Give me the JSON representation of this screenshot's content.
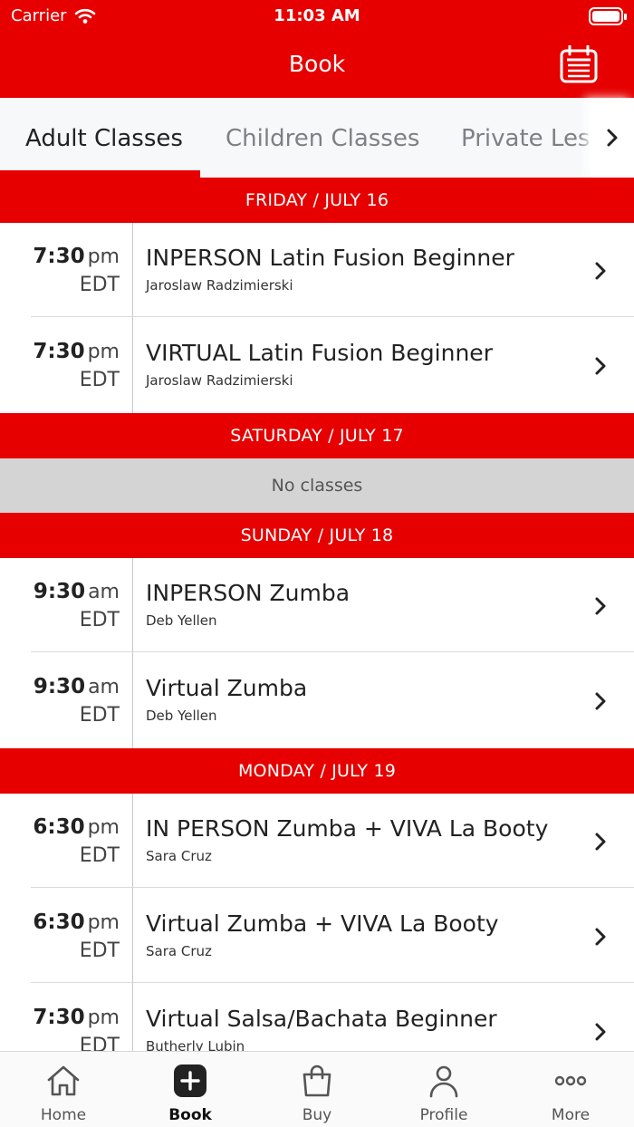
{
  "status_bar": {
    "carrier": "Carrier",
    "time": "11:03 AM"
  },
  "nav": {
    "title": "Book",
    "calendar_icon": "calendar-icon"
  },
  "tabs": [
    {
      "label": "Adult Classes",
      "active": true
    },
    {
      "label": "Children Classes",
      "active": false
    },
    {
      "label": "Private Lessons",
      "active": false
    }
  ],
  "days": [
    {
      "header": "FRIDAY / JULY 16",
      "classes": [
        {
          "time": "7:30",
          "ampm": "pm",
          "tz": "EDT",
          "title": "INPERSON Latin Fusion Beginner",
          "instructor": "Jaroslaw Radzimierski"
        },
        {
          "time": "7:30",
          "ampm": "pm",
          "tz": "EDT",
          "title": "VIRTUAL Latin Fusion Beginner",
          "instructor": "Jaroslaw Radzimierski"
        }
      ]
    },
    {
      "header": "SATURDAY / JULY 17",
      "empty": "No classes"
    },
    {
      "header": "SUNDAY / JULY 18",
      "classes": [
        {
          "time": "9:30",
          "ampm": "am",
          "tz": "EDT",
          "title": "INPERSON Zumba",
          "instructor": "Deb Yellen"
        },
        {
          "time": "9:30",
          "ampm": "am",
          "tz": "EDT",
          "title": "Virtual Zumba",
          "instructor": "Deb Yellen"
        }
      ]
    },
    {
      "header": "MONDAY / JULY 19",
      "classes": [
        {
          "time": "6:30",
          "ampm": "pm",
          "tz": "EDT",
          "title": "IN PERSON Zumba + VIVA La Booty",
          "instructor": "Sara Cruz"
        },
        {
          "time": "6:30",
          "ampm": "pm",
          "tz": "EDT",
          "title": "Virtual Zumba + VIVA La Booty",
          "instructor": "Sara Cruz"
        },
        {
          "time": "7:30",
          "ampm": "pm",
          "tz": "EDT",
          "title": "Virtual Salsa/Bachata Beginner",
          "instructor": "Butherly Lubin"
        }
      ]
    }
  ],
  "tabbar": [
    {
      "label": "Home",
      "icon": "home-icon",
      "active": false
    },
    {
      "label": "Book",
      "icon": "plus-square-icon",
      "active": true
    },
    {
      "label": "Buy",
      "icon": "shopping-bag-icon",
      "active": false
    },
    {
      "label": "Profile",
      "icon": "person-icon",
      "active": false
    },
    {
      "label": "More",
      "icon": "more-dots-icon",
      "active": false
    }
  ],
  "colors": {
    "brand": "#e60000",
    "no_classes_bg": "#d4d4d4"
  }
}
